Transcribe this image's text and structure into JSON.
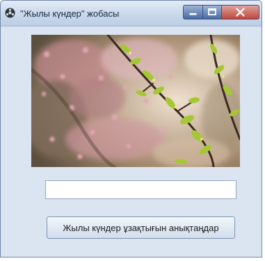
{
  "window": {
    "title": "\"Жылы күндер\" жобасы",
    "icons": {
      "app": "app-icon",
      "minimize": "minimize-icon",
      "maximize": "maximize-icon",
      "close": "close-icon"
    }
  },
  "photo": {
    "subject": "blossoming branch"
  },
  "input": {
    "value": "",
    "placeholder": ""
  },
  "button": {
    "label": "Жылы күндер ұзақтығын анықтаңдар"
  },
  "colors": {
    "window_bg": "#dbe5f1",
    "titlebar": "#c9d8ea",
    "close": "#c3463a"
  }
}
